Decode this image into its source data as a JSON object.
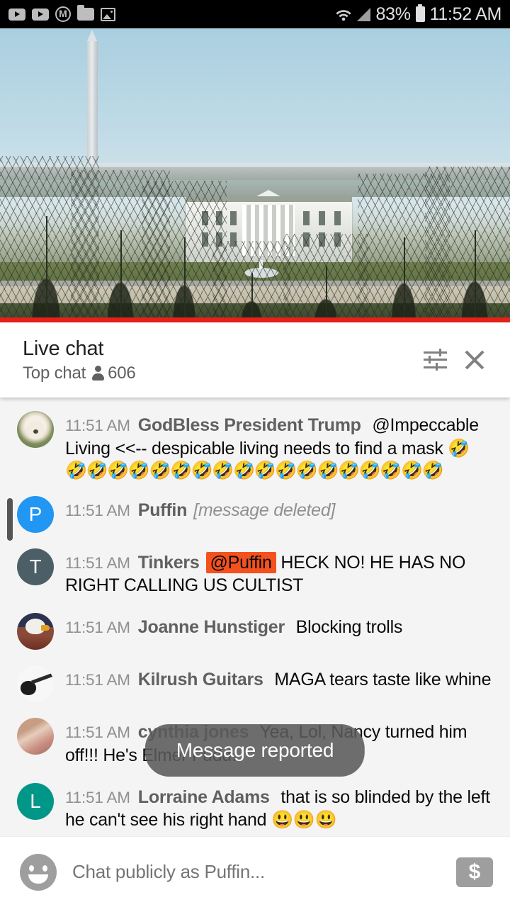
{
  "status_bar": {
    "icons": [
      "youtube-icon",
      "youtube-icon",
      "m-circle-icon",
      "folder-icon",
      "image-icon"
    ],
    "wifi_icon": "wifi-icon",
    "signal_icon": "signal-icon",
    "battery_percent": "83%",
    "battery_icon": "battery-icon",
    "time": "11:52 AM"
  },
  "video": {
    "name": "live-stream-white-house",
    "progress_color": "#e62117",
    "progress_percent": 100
  },
  "chat_header": {
    "title": "Live chat",
    "mode": "Top chat",
    "viewer_count": "606",
    "viewer_icon": "person-icon",
    "tune_icon": "tune-icon",
    "close_icon": "close-icon"
  },
  "messages": [
    {
      "time": "11:51 AM",
      "author": "GodBless President Trump",
      "text": " @Impeccable Living <<-- despicable living needs to find a mask 🤣",
      "emoji_row": "🤣🤣🤣🤣🤣🤣🤣🤣🤣🤣🤣🤣🤣🤣🤣🤣🤣🤣",
      "avatar_type": "photo-dog",
      "avatar_letter": "",
      "deleted": false,
      "mention": "",
      "highlighted": false
    },
    {
      "time": "11:51 AM",
      "author": "Puffin",
      "text": "[message deleted]",
      "emoji_row": "",
      "avatar_type": "letter-p",
      "avatar_letter": "P",
      "deleted": true,
      "mention": "",
      "highlighted": true
    },
    {
      "time": "11:51 AM",
      "author": "Tinkers",
      "mention": "@Puffin",
      "text": " HECK NO! HE HAS NO RIGHT CALLING US CULTIST",
      "emoji_row": "",
      "avatar_type": "letter-t",
      "avatar_letter": "T",
      "deleted": false,
      "highlighted": false
    },
    {
      "time": "11:51 AM",
      "author": "Joanne Hunstiger",
      "text": " Blocking trolls",
      "emoji_row": "",
      "avatar_type": "photo-eagle",
      "avatar_letter": "",
      "deleted": false,
      "mention": "",
      "highlighted": false
    },
    {
      "time": "11:51 AM",
      "author": "Kilrush Guitars",
      "text": " MAGA tears taste like whine",
      "emoji_row": "",
      "avatar_type": "photo-guitar",
      "avatar_letter": "",
      "deleted": false,
      "mention": "",
      "highlighted": false
    },
    {
      "time": "11:51 AM",
      "author": "cynthia jones",
      "text": " Yea, Lol, Nancy turned him off!!! He's Elmer Fudd.",
      "emoji_row": "",
      "avatar_type": "photo-pink",
      "avatar_letter": "",
      "deleted": false,
      "mention": "",
      "highlighted": false
    },
    {
      "time": "11:51 AM",
      "author": "Lorraine Adams",
      "text": " that is so blinded by the left he can't see his right hand 😃😃😃",
      "emoji_row": "",
      "avatar_type": "letter-l",
      "avatar_letter": "L",
      "deleted": false,
      "mention": "",
      "highlighted": false
    }
  ],
  "toast": {
    "text": "Message reported"
  },
  "input_bar": {
    "emoji_icon": "emoji-icon",
    "placeholder": "Chat publicly as Puffin...",
    "superchat_icon": "dollar-icon",
    "superchat_glyph": "$"
  }
}
